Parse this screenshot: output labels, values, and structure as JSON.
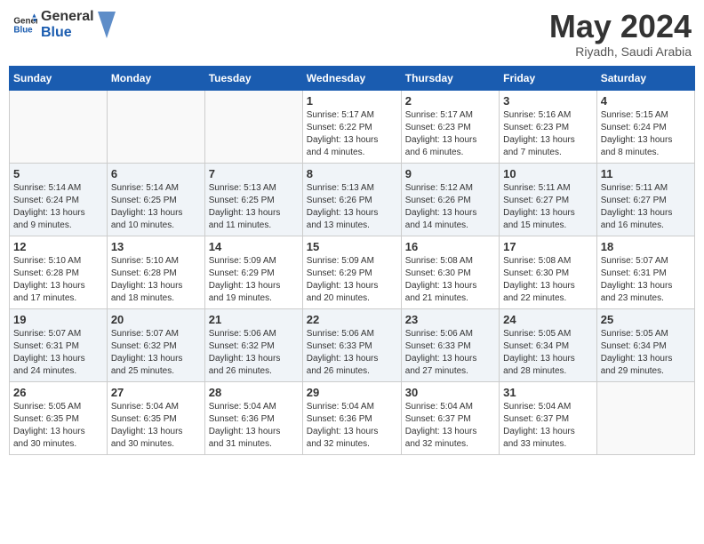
{
  "logo": {
    "line1": "General",
    "line2": "Blue"
  },
  "title": "May 2024",
  "subtitle": "Riyadh, Saudi Arabia",
  "weekdays": [
    "Sunday",
    "Monday",
    "Tuesday",
    "Wednesday",
    "Thursday",
    "Friday",
    "Saturday"
  ],
  "weeks": [
    [
      {
        "day": "",
        "info": ""
      },
      {
        "day": "",
        "info": ""
      },
      {
        "day": "",
        "info": ""
      },
      {
        "day": "1",
        "info": "Sunrise: 5:17 AM\nSunset: 6:22 PM\nDaylight: 13 hours\nand 4 minutes."
      },
      {
        "day": "2",
        "info": "Sunrise: 5:17 AM\nSunset: 6:23 PM\nDaylight: 13 hours\nand 6 minutes."
      },
      {
        "day": "3",
        "info": "Sunrise: 5:16 AM\nSunset: 6:23 PM\nDaylight: 13 hours\nand 7 minutes."
      },
      {
        "day": "4",
        "info": "Sunrise: 5:15 AM\nSunset: 6:24 PM\nDaylight: 13 hours\nand 8 minutes."
      }
    ],
    [
      {
        "day": "5",
        "info": "Sunrise: 5:14 AM\nSunset: 6:24 PM\nDaylight: 13 hours\nand 9 minutes."
      },
      {
        "day": "6",
        "info": "Sunrise: 5:14 AM\nSunset: 6:25 PM\nDaylight: 13 hours\nand 10 minutes."
      },
      {
        "day": "7",
        "info": "Sunrise: 5:13 AM\nSunset: 6:25 PM\nDaylight: 13 hours\nand 11 minutes."
      },
      {
        "day": "8",
        "info": "Sunrise: 5:13 AM\nSunset: 6:26 PM\nDaylight: 13 hours\nand 13 minutes."
      },
      {
        "day": "9",
        "info": "Sunrise: 5:12 AM\nSunset: 6:26 PM\nDaylight: 13 hours\nand 14 minutes."
      },
      {
        "day": "10",
        "info": "Sunrise: 5:11 AM\nSunset: 6:27 PM\nDaylight: 13 hours\nand 15 minutes."
      },
      {
        "day": "11",
        "info": "Sunrise: 5:11 AM\nSunset: 6:27 PM\nDaylight: 13 hours\nand 16 minutes."
      }
    ],
    [
      {
        "day": "12",
        "info": "Sunrise: 5:10 AM\nSunset: 6:28 PM\nDaylight: 13 hours\nand 17 minutes."
      },
      {
        "day": "13",
        "info": "Sunrise: 5:10 AM\nSunset: 6:28 PM\nDaylight: 13 hours\nand 18 minutes."
      },
      {
        "day": "14",
        "info": "Sunrise: 5:09 AM\nSunset: 6:29 PM\nDaylight: 13 hours\nand 19 minutes."
      },
      {
        "day": "15",
        "info": "Sunrise: 5:09 AM\nSunset: 6:29 PM\nDaylight: 13 hours\nand 20 minutes."
      },
      {
        "day": "16",
        "info": "Sunrise: 5:08 AM\nSunset: 6:30 PM\nDaylight: 13 hours\nand 21 minutes."
      },
      {
        "day": "17",
        "info": "Sunrise: 5:08 AM\nSunset: 6:30 PM\nDaylight: 13 hours\nand 22 minutes."
      },
      {
        "day": "18",
        "info": "Sunrise: 5:07 AM\nSunset: 6:31 PM\nDaylight: 13 hours\nand 23 minutes."
      }
    ],
    [
      {
        "day": "19",
        "info": "Sunrise: 5:07 AM\nSunset: 6:31 PM\nDaylight: 13 hours\nand 24 minutes."
      },
      {
        "day": "20",
        "info": "Sunrise: 5:07 AM\nSunset: 6:32 PM\nDaylight: 13 hours\nand 25 minutes."
      },
      {
        "day": "21",
        "info": "Sunrise: 5:06 AM\nSunset: 6:32 PM\nDaylight: 13 hours\nand 26 minutes."
      },
      {
        "day": "22",
        "info": "Sunrise: 5:06 AM\nSunset: 6:33 PM\nDaylight: 13 hours\nand 26 minutes."
      },
      {
        "day": "23",
        "info": "Sunrise: 5:06 AM\nSunset: 6:33 PM\nDaylight: 13 hours\nand 27 minutes."
      },
      {
        "day": "24",
        "info": "Sunrise: 5:05 AM\nSunset: 6:34 PM\nDaylight: 13 hours\nand 28 minutes."
      },
      {
        "day": "25",
        "info": "Sunrise: 5:05 AM\nSunset: 6:34 PM\nDaylight: 13 hours\nand 29 minutes."
      }
    ],
    [
      {
        "day": "26",
        "info": "Sunrise: 5:05 AM\nSunset: 6:35 PM\nDaylight: 13 hours\nand 30 minutes."
      },
      {
        "day": "27",
        "info": "Sunrise: 5:04 AM\nSunset: 6:35 PM\nDaylight: 13 hours\nand 30 minutes."
      },
      {
        "day": "28",
        "info": "Sunrise: 5:04 AM\nSunset: 6:36 PM\nDaylight: 13 hours\nand 31 minutes."
      },
      {
        "day": "29",
        "info": "Sunrise: 5:04 AM\nSunset: 6:36 PM\nDaylight: 13 hours\nand 32 minutes."
      },
      {
        "day": "30",
        "info": "Sunrise: 5:04 AM\nSunset: 6:37 PM\nDaylight: 13 hours\nand 32 minutes."
      },
      {
        "day": "31",
        "info": "Sunrise: 5:04 AM\nSunset: 6:37 PM\nDaylight: 13 hours\nand 33 minutes."
      },
      {
        "day": "",
        "info": ""
      }
    ]
  ]
}
